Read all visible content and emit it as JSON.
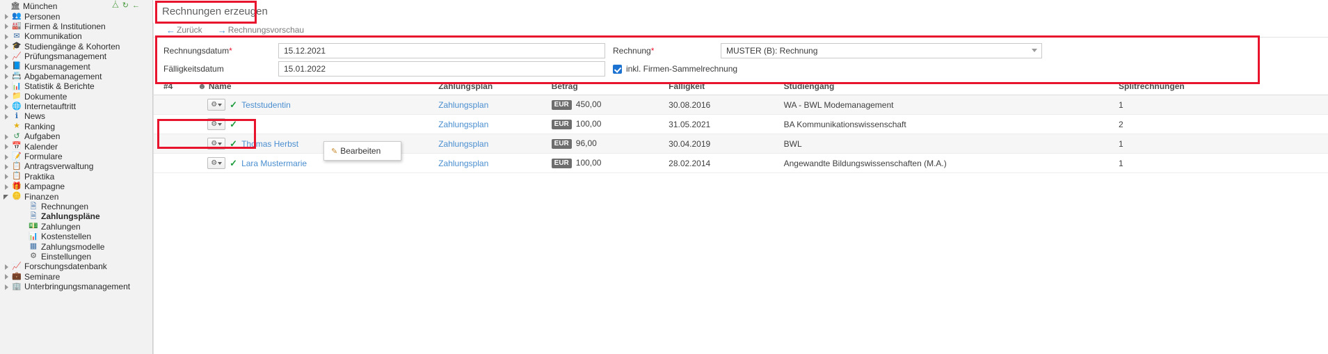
{
  "sidebar": {
    "root": {
      "label": "München",
      "icon": "bank-icon"
    },
    "header_icons": [
      {
        "name": "collapse-all-icon",
        "glyph": "⤨"
      },
      {
        "name": "refresh-icon",
        "glyph": "↻"
      }
    ],
    "items": [
      {
        "label": "Personen",
        "icon": "people-icon",
        "level": 1,
        "arrow": "closed",
        "bold": false
      },
      {
        "label": "Firmen & Institutionen",
        "icon": "company-icon",
        "level": 1,
        "arrow": "closed",
        "bold": false
      },
      {
        "label": "Kommunikation",
        "icon": "mail-icon",
        "level": 1,
        "arrow": "closed",
        "bold": false
      },
      {
        "label": "Studiengänge & Kohorten",
        "icon": "graduation-icon",
        "level": 1,
        "arrow": "closed",
        "bold": false
      },
      {
        "label": "Prüfungsmanagement",
        "icon": "exam-icon",
        "level": 1,
        "arrow": "closed",
        "bold": false
      },
      {
        "label": "Kursmanagement",
        "icon": "book-icon",
        "level": 1,
        "arrow": "closed",
        "bold": false
      },
      {
        "label": "Abgabemanagement",
        "icon": "card-icon",
        "level": 1,
        "arrow": "closed",
        "bold": false
      },
      {
        "label": "Statistik & Berichte",
        "icon": "chart-icon",
        "level": 1,
        "arrow": "closed",
        "bold": false
      },
      {
        "label": "Dokumente",
        "icon": "folder-icon",
        "level": 1,
        "arrow": "closed",
        "bold": false
      },
      {
        "label": "Internetauftritt",
        "icon": "globe-icon",
        "level": 1,
        "arrow": "closed",
        "bold": false
      },
      {
        "label": "News",
        "icon": "info-icon",
        "level": 1,
        "arrow": "closed",
        "bold": false
      },
      {
        "label": "Ranking",
        "icon": "star-icon",
        "level": 1,
        "arrow": "none",
        "bold": false
      },
      {
        "label": "Aufgaben",
        "icon": "clock-icon",
        "level": 1,
        "arrow": "closed",
        "bold": false
      },
      {
        "label": "Kalender",
        "icon": "calendar-icon",
        "level": 1,
        "arrow": "closed",
        "bold": false
      },
      {
        "label": "Formulare",
        "icon": "form-icon",
        "level": 1,
        "arrow": "closed",
        "bold": false
      },
      {
        "label": "Antragsverwaltung",
        "icon": "application-icon",
        "level": 1,
        "arrow": "closed",
        "bold": false
      },
      {
        "label": "Praktika",
        "icon": "internship-icon",
        "level": 1,
        "arrow": "closed",
        "bold": false
      },
      {
        "label": "Kampagne",
        "icon": "gift-icon",
        "level": 1,
        "arrow": "closed",
        "bold": false
      },
      {
        "label": "Finanzen",
        "icon": "coins-icon",
        "level": 1,
        "arrow": "open",
        "bold": false
      },
      {
        "label": "Rechnungen",
        "icon": "invoice-icon",
        "level": 2,
        "arrow": "none",
        "bold": false
      },
      {
        "label": "Zahlungspläne",
        "icon": "paymentplan-icon",
        "level": 2,
        "arrow": "none",
        "bold": true
      },
      {
        "label": "Zahlungen",
        "icon": "money-icon",
        "level": 2,
        "arrow": "none",
        "bold": false
      },
      {
        "label": "Kostenstellen",
        "icon": "costcenter-icon",
        "level": 2,
        "arrow": "none",
        "bold": false
      },
      {
        "label": "Zahlungsmodelle",
        "icon": "grid-icon",
        "level": 2,
        "arrow": "none",
        "bold": false
      },
      {
        "label": "Einstellungen",
        "icon": "gear-icon",
        "level": 2,
        "arrow": "none",
        "bold": false
      },
      {
        "label": "Forschungsdatenbank",
        "icon": "research-icon",
        "level": 1,
        "arrow": "closed",
        "bold": false
      },
      {
        "label": "Seminare",
        "icon": "briefcase-icon",
        "level": 1,
        "arrow": "closed",
        "bold": false
      },
      {
        "label": "Unterbringungsmanagement",
        "icon": "housing-icon",
        "level": 1,
        "arrow": "closed",
        "bold": false
      }
    ]
  },
  "header": {
    "title": "Rechnungen erzeugen"
  },
  "breadcrumb": {
    "back": {
      "label": "Zurück",
      "arrow": "←"
    },
    "preview": {
      "label": "Rechnungsvorschau",
      "arrow": "→"
    }
  },
  "form": {
    "invoice_date": {
      "label": "Rechnungsdatum",
      "required": "*",
      "value": "15.12.2021"
    },
    "due_date": {
      "label": "Fälligkeitsdatum",
      "required": "",
      "value": "15.01.2022"
    },
    "invoice_template": {
      "label": "Rechnung",
      "required": "*",
      "value": "MUSTER (B): Rechnung"
    },
    "collective_invoice": {
      "label": "inkl. Firmen-Sammelrechnung",
      "checked": true
    }
  },
  "table": {
    "columns": {
      "count": "#4",
      "name": "Name",
      "payment_plan": "Zahlungsplan",
      "amount": "Betrag",
      "due": "Fälligkeit",
      "program": "Studiengang",
      "split": "Splitrechnungen"
    },
    "rows": [
      {
        "name": "Teststudentin",
        "payment_plan": "Zahlungsplan",
        "currency": "EUR",
        "amount": "450,00",
        "due": "30.08.2016",
        "program": "WA - BWL Modemanagement",
        "split": "1"
      },
      {
        "name": "",
        "payment_plan": "Zahlungsplan",
        "currency": "EUR",
        "amount": "100,00",
        "due": "31.05.2021",
        "program": "BA Kommunikationswissenschaft",
        "split": "2"
      },
      {
        "name": "Thomas Herbst",
        "payment_plan": "Zahlungsplan",
        "currency": "EUR",
        "amount": "96,00",
        "due": "30.04.2019",
        "program": "BWL",
        "split": "1"
      },
      {
        "name": "Lara Mustermarie",
        "payment_plan": "Zahlungsplan",
        "currency": "EUR",
        "amount": "100,00",
        "due": "28.02.2014",
        "program": "Angewandte Bildungswissenschaften (M.A.)",
        "split": "1"
      }
    ]
  },
  "context_menu": {
    "items": [
      {
        "label": "Bearbeiten",
        "icon": "pencil-icon"
      }
    ]
  },
  "colors": {
    "highlight_red": "#e8142d",
    "link_blue": "#4a8ed0",
    "check_green": "#1f9d3e",
    "badge_gray": "#6d6d6d",
    "accent_blue": "#1b72d0"
  }
}
